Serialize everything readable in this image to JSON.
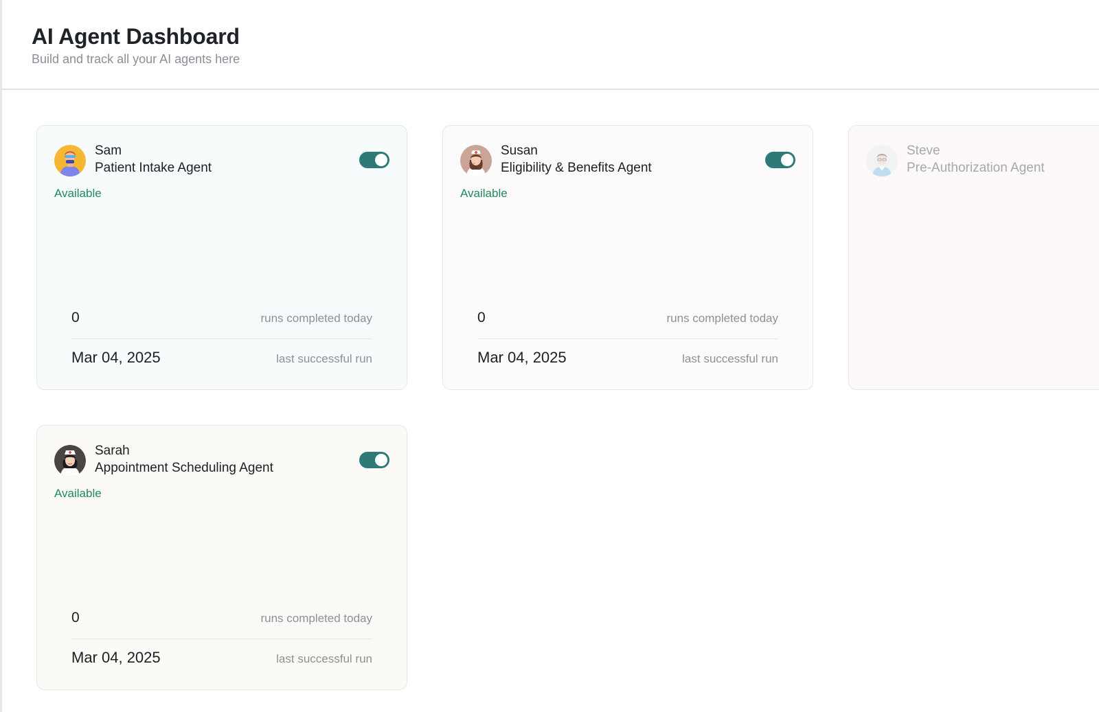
{
  "header": {
    "title": "AI Agent Dashboard",
    "subtitle": "Build and track all your AI agents here"
  },
  "colors": {
    "accent_toggle": "#2e7a78",
    "status_available": "#1f8a5a",
    "muted_text": "#8c9198"
  },
  "agents": [
    {
      "name": "Sam",
      "role": "Patient Intake Agent",
      "status": "Available",
      "enabled": true,
      "avatar_icon": "male-agent-avatar-icon",
      "runs_today": "0",
      "runs_label": "runs completed today",
      "last_run": "Mar 04, 2025",
      "last_run_label": "last successful run"
    },
    {
      "name": "Susan",
      "role": "Eligibility & Benefits Agent",
      "status": "Available",
      "enabled": true,
      "avatar_icon": "nurse-avatar-icon",
      "runs_today": "0",
      "runs_label": "runs completed today",
      "last_run": "Mar 04, 2025",
      "last_run_label": "last successful run"
    },
    {
      "name": "Steve",
      "role": "Pre-Authorization Agent",
      "enabled": false,
      "avatar_icon": "doctor-avatar-icon"
    },
    {
      "name": "Sarah",
      "role": "Appointment Scheduling Agent",
      "status": "Available",
      "enabled": true,
      "avatar_icon": "nurse-cap-avatar-icon",
      "runs_today": "0",
      "runs_label": "runs completed today",
      "last_run": "Mar 04, 2025",
      "last_run_label": "last successful run"
    }
  ]
}
